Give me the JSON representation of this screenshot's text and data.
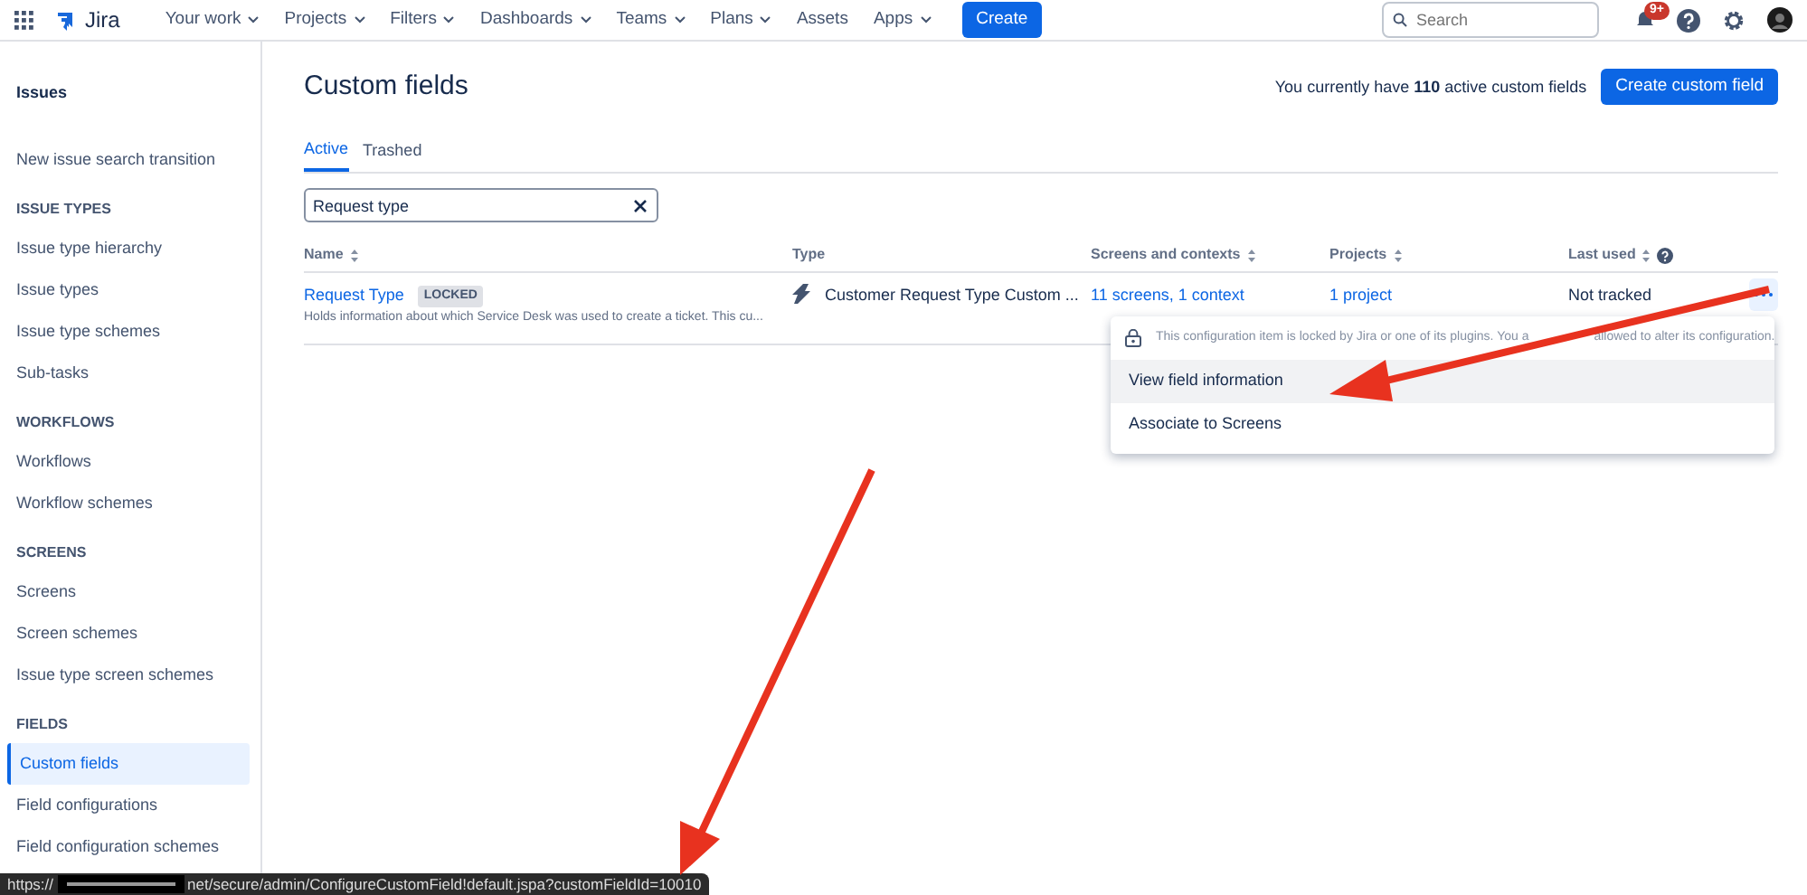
{
  "app": {
    "name": "Jira"
  },
  "nav": [
    {
      "label": "Your work",
      "dropdown": true
    },
    {
      "label": "Projects",
      "dropdown": true
    },
    {
      "label": "Filters",
      "dropdown": true
    },
    {
      "label": "Dashboards",
      "dropdown": true
    },
    {
      "label": "Teams",
      "dropdown": true
    },
    {
      "label": "Plans",
      "dropdown": true
    },
    {
      "label": "Assets",
      "dropdown": false
    },
    {
      "label": "Apps",
      "dropdown": true
    }
  ],
  "create_button": "Create",
  "search": {
    "placeholder": "Search"
  },
  "notifications_badge": "9+",
  "sidebar": {
    "title": "Issues",
    "sections": [
      {
        "items": [
          {
            "label": "New issue search transition",
            "selected": false
          }
        ]
      },
      {
        "heading": "ISSUE TYPES",
        "items": [
          {
            "label": "Issue type hierarchy",
            "selected": false
          },
          {
            "label": "Issue types",
            "selected": false
          },
          {
            "label": "Issue type schemes",
            "selected": false
          },
          {
            "label": "Sub-tasks",
            "selected": false
          }
        ]
      },
      {
        "heading": "WORKFLOWS",
        "items": [
          {
            "label": "Workflows",
            "selected": false
          },
          {
            "label": "Workflow schemes",
            "selected": false
          }
        ]
      },
      {
        "heading": "SCREENS",
        "items": [
          {
            "label": "Screens",
            "selected": false
          },
          {
            "label": "Screen schemes",
            "selected": false
          },
          {
            "label": "Issue type screen schemes",
            "selected": false
          }
        ]
      },
      {
        "heading": "FIELDS",
        "items": [
          {
            "label": "Custom fields",
            "selected": true
          },
          {
            "label": "Field configurations",
            "selected": false
          },
          {
            "label": "Field configuration schemes",
            "selected": false
          }
        ]
      }
    ]
  },
  "page": {
    "title": "Custom fields",
    "summary": "You currently have **110** active custom fields",
    "create_button": "Create custom field",
    "tabs": [
      {
        "label": "Active",
        "selected": true
      },
      {
        "label": "Trashed",
        "selected": false
      }
    ],
    "filter": {
      "value": "Request type"
    },
    "table": {
      "columns": [
        {
          "label": "Name",
          "sortable": true
        },
        {
          "label": "Type",
          "sortable": false
        },
        {
          "label": "Screens and contexts",
          "sortable": true
        },
        {
          "label": "Projects",
          "sortable": true
        },
        {
          "label": "Last used",
          "sortable": true,
          "help": true
        }
      ],
      "rows": [
        {
          "name": "Request Type",
          "tag": "LOCKED",
          "description": "Holds information about which Service Desk was used to create a ticket. This cu...",
          "type": "Customer Request Type Custom ...",
          "screens": "11 screens, 1 context",
          "projects": "1 project",
          "last_used": "Not tracked"
        }
      ]
    }
  },
  "action_menu": {
    "notice": [
      "This configuration item is locked by Jira or one of its plugins. You a",
      "allowed to alter its configuration."
    ],
    "items": [
      {
        "label": "View field information",
        "selected": true
      },
      {
        "label": "Associate to Screens",
        "selected": false
      }
    ]
  },
  "status_bar": {
    "prefix": "https://",
    "url": "net/secure/admin/ConfigureCustomField!default.jspa?customFieldId=10010"
  }
}
